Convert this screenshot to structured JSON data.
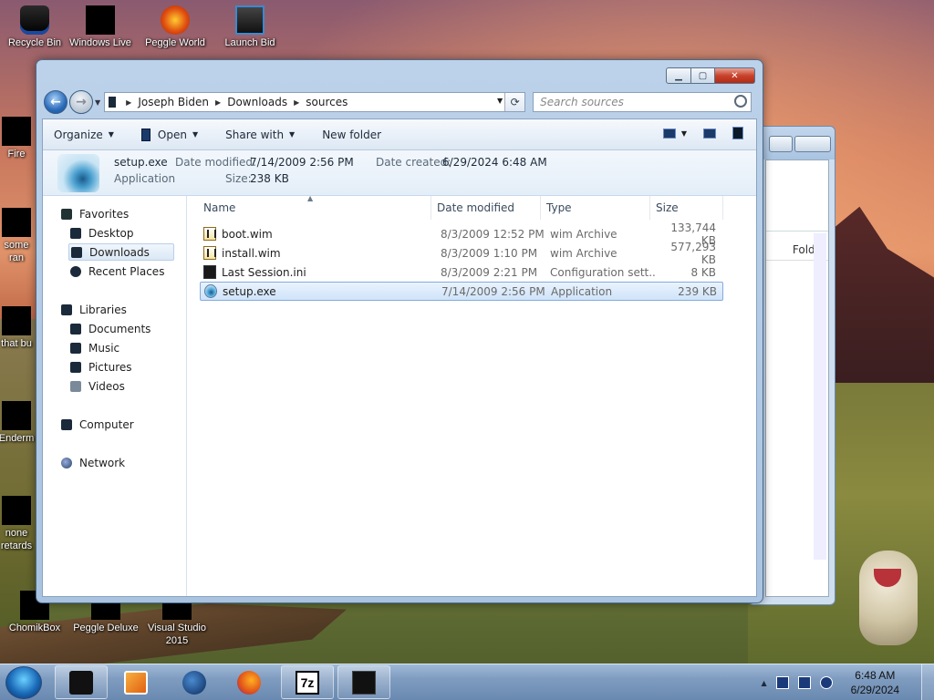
{
  "desktop": {
    "icons": [
      {
        "label": "Recycle Bin",
        "kind": "bin"
      },
      {
        "label": "Windows Live",
        "kind": "black"
      },
      {
        "label": "Peggle World",
        "kind": "circle"
      },
      {
        "label": "Launch Bid",
        "kind": "tower"
      },
      {
        "label": "Fire",
        "kind": "black"
      },
      {
        "label": "some",
        "kind": "black"
      },
      {
        "label": "ran",
        "kind": "none"
      },
      {
        "label": "that bu",
        "kind": "black"
      },
      {
        "label": "Enderm",
        "kind": "black"
      },
      {
        "label": "none",
        "kind": "black"
      },
      {
        "label": "retards",
        "kind": "none"
      },
      {
        "label": "ChomikBox",
        "kind": "black"
      },
      {
        "label": "Peggle Deluxe",
        "kind": "black"
      },
      {
        "label": "Visual Studio",
        "kind": "black"
      },
      {
        "label": "2015",
        "kind": "none"
      }
    ]
  },
  "explorer": {
    "controls": {
      "minimize": "▁",
      "maximize": "▢",
      "close": "✕"
    },
    "address": {
      "crumbs": [
        "Joseph Biden",
        "Downloads",
        "sources"
      ],
      "refresh_icon": "⟳"
    },
    "search": {
      "placeholder": "Search sources"
    },
    "toolbar": {
      "organize": "Organize",
      "open": "Open",
      "share_with": "Share with",
      "new_folder": "New folder"
    },
    "details": {
      "name": "setup.exe",
      "type": "Application",
      "date_modified_label": "Date modified:",
      "date_modified": "7/14/2009 2:56 PM",
      "date_created_label": "Date created:",
      "date_created": "6/29/2024 6:48 AM",
      "size_label": "Size:",
      "size": "238 KB"
    },
    "nav": {
      "favorites": "Favorites",
      "desktop": "Desktop",
      "downloads": "Downloads",
      "recent_places": "Recent Places",
      "libraries": "Libraries",
      "documents": "Documents",
      "music": "Music",
      "pictures": "Pictures",
      "videos": "Videos",
      "computer": "Computer",
      "network": "Network"
    },
    "columns": {
      "name": "Name",
      "date_modified": "Date modified",
      "type": "Type",
      "size": "Size"
    },
    "files": [
      {
        "name": "boot.wim",
        "date": "8/3/2009 12:52 PM",
        "type": "wim Archive",
        "size": "133,744 KB",
        "icon": "wim"
      },
      {
        "name": "install.wim",
        "date": "8/3/2009 1:10 PM",
        "type": "wim Archive",
        "size": "577,293 KB",
        "icon": "wim"
      },
      {
        "name": "Last Session.ini",
        "date": "8/3/2009 2:21 PM",
        "type": "Configuration sett...",
        "size": "8 KB",
        "icon": "ini"
      },
      {
        "name": "setup.exe",
        "date": "7/14/2009 2:56 PM",
        "type": "Application",
        "size": "239 KB",
        "icon": "exe"
      }
    ]
  },
  "bg_window": {
    "column_header": "Folder"
  },
  "taskbar": {
    "clock_time": "6:48 AM",
    "clock_date": "6/29/2024",
    "apps": [
      "explorer-icon",
      "media-player-icon",
      "globe-icon",
      "firefox-icon",
      "7zip-icon",
      "terminal-icon"
    ],
    "sevenzip_label": "7z"
  },
  "colors": {
    "accent": "#2a6ab8",
    "selection": "#cfe3f9",
    "taskbar": "#7f9cc0"
  }
}
